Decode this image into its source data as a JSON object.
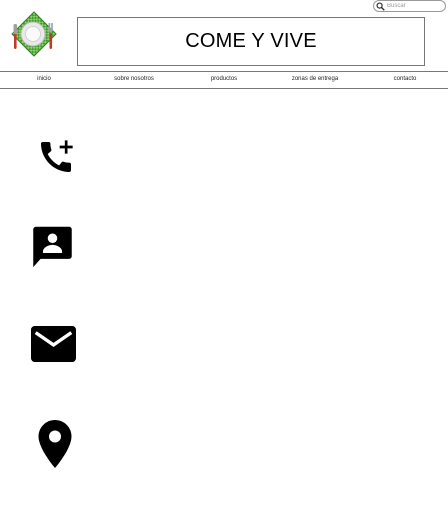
{
  "search": {
    "placeholder": "Buscar"
  },
  "header": {
    "title": "COME Y VIVE"
  },
  "nav": {
    "items": [
      {
        "label": "inicio"
      },
      {
        "label": "sobre nosotros"
      },
      {
        "label": "productos"
      },
      {
        "label": "zonas de entrega"
      },
      {
        "label": "contacto"
      }
    ]
  },
  "icons": {
    "logo": "plate-fork-knife-logo",
    "search": "search-icon",
    "contact": [
      "add-call-icon",
      "contact-message-icon",
      "mail-icon",
      "location-pin-icon"
    ]
  },
  "colors": {
    "logo_green": "#6ab04c",
    "logo_fork": "#c0392b",
    "icon": "#000000"
  }
}
